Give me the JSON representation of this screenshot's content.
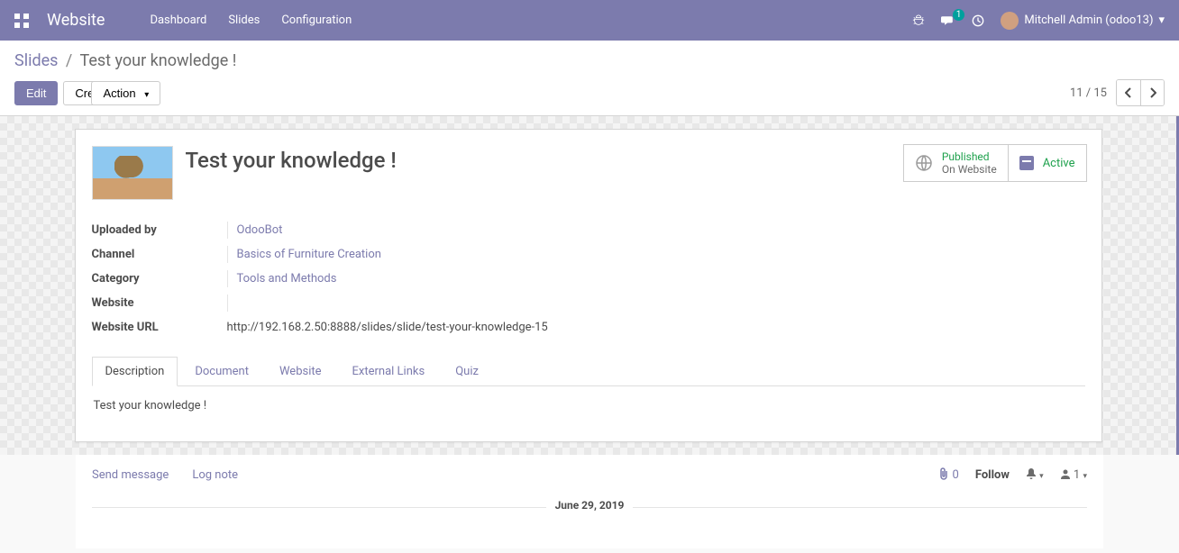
{
  "topnav": {
    "brand": "Website",
    "menu": [
      "Dashboard",
      "Slides",
      "Configuration"
    ],
    "msg_count": "1",
    "user": "Mitchell Admin (odoo13)"
  },
  "breadcrumb": {
    "root": "Slides",
    "current": "Test your knowledge !"
  },
  "buttons": {
    "edit": "Edit",
    "create": "Create",
    "action": "Action"
  },
  "pager": {
    "pos": "11",
    "total": "15"
  },
  "status": {
    "published": "Published",
    "on_website": "On Website",
    "active": "Active"
  },
  "record": {
    "title": "Test your knowledge !",
    "labels": {
      "uploaded_by": "Uploaded by",
      "channel": "Channel",
      "category": "Category",
      "website": "Website",
      "website_url": "Website URL"
    },
    "values": {
      "uploaded_by": "OdooBot",
      "channel": "Basics of Furniture Creation",
      "category": "Tools and Methods",
      "website": "",
      "website_url": "http://192.168.2.50:8888/slides/slide/test-your-knowledge-15"
    }
  },
  "tabs": {
    "items": [
      "Description",
      "Document",
      "Website",
      "External Links",
      "Quiz"
    ],
    "description_content": "Test your knowledge !"
  },
  "chatter": {
    "send": "Send message",
    "log": "Log note",
    "attach_count": "0",
    "follow": "Follow",
    "followers": "1",
    "date": "June 29, 2019"
  }
}
